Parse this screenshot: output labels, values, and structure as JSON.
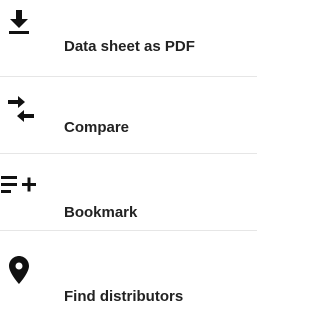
{
  "actions": {
    "datasheet": {
      "label": "Data sheet as PDF",
      "icon": "download-icon"
    },
    "compare": {
      "label": "Compare",
      "icon": "compare-arrows-icon"
    },
    "bookmark": {
      "label": "Bookmark",
      "icon": "playlist-add-icon"
    },
    "distributors": {
      "label": "Find distributors",
      "icon": "map-pin-icon"
    }
  },
  "colors": {
    "text": "#222222",
    "icon": "#111111",
    "divider": "#e6e6e6"
  }
}
